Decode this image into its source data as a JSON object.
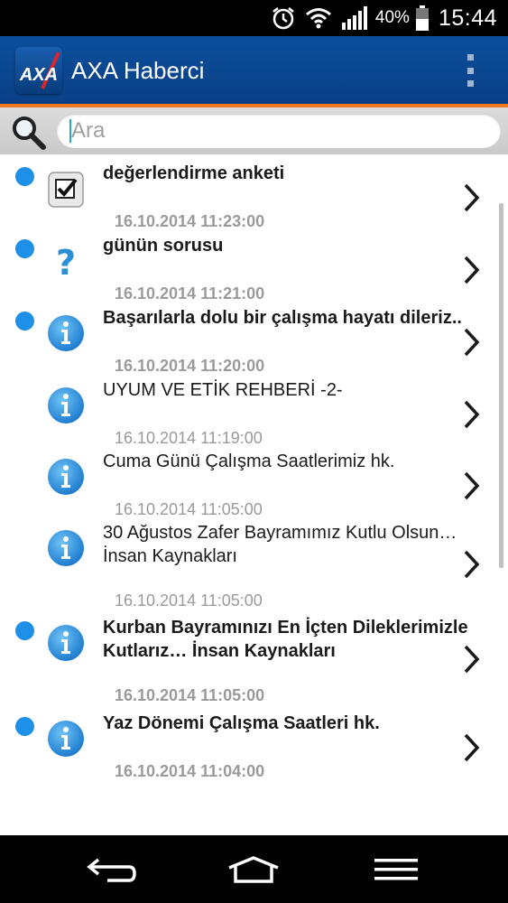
{
  "status_bar": {
    "icons": [
      "alarm-icon",
      "wifi-icon",
      "signal-icon",
      "battery-icon"
    ],
    "battery": "40%",
    "time": "15:44"
  },
  "app_bar": {
    "logo_text": "AXA",
    "title": "AXA Haberci",
    "accent_color": "#0b4f9c",
    "divider_color": "#f07a1a"
  },
  "search": {
    "placeholder": "Ara",
    "value": ""
  },
  "messages": [
    {
      "title": "değerlendirme anketi",
      "date": "16.10.2014 11:23:00",
      "unread": true,
      "icon": "survey-checkbox-icon"
    },
    {
      "title": "günün sorusu",
      "date": "16.10.2014 11:21:00",
      "unread": true,
      "icon": "question-icon"
    },
    {
      "title": "Başarılarla dolu bir çalışma hayatı dileriz..",
      "date": "16.10.2014 11:20:00",
      "unread": true,
      "icon": "info-icon"
    },
    {
      "title": "UYUM VE ETİK REHBERİ -2-",
      "date": "16.10.2014 11:19:00",
      "unread": false,
      "icon": "info-icon"
    },
    {
      "title": "Cuma Günü Çalışma Saatlerimiz hk.",
      "date": "16.10.2014 11:05:00",
      "unread": false,
      "icon": "info-icon"
    },
    {
      "title": "30 Ağustos Zafer Bayramımız Kutlu Olsun… İnsan Kaynakları",
      "date": "16.10.2014 11:05:00",
      "unread": false,
      "icon": "info-icon"
    },
    {
      "title": "Kurban Bayramınızı En İçten Dileklerimizle Kutlarız… İnsan Kaynakları",
      "date": "16.10.2014 11:05:00",
      "unread": true,
      "icon": "info-icon"
    },
    {
      "title": "Yaz Dönemi Çalışma Saatleri hk.",
      "date": "16.10.2014 11:04:00",
      "unread": true,
      "icon": "info-icon"
    }
  ],
  "colors": {
    "unread_dot": "#1e90e8",
    "date_text": "#9a9a9a"
  },
  "nav_bar": {
    "icons": [
      "back-icon",
      "home-icon",
      "menu-icon"
    ]
  }
}
